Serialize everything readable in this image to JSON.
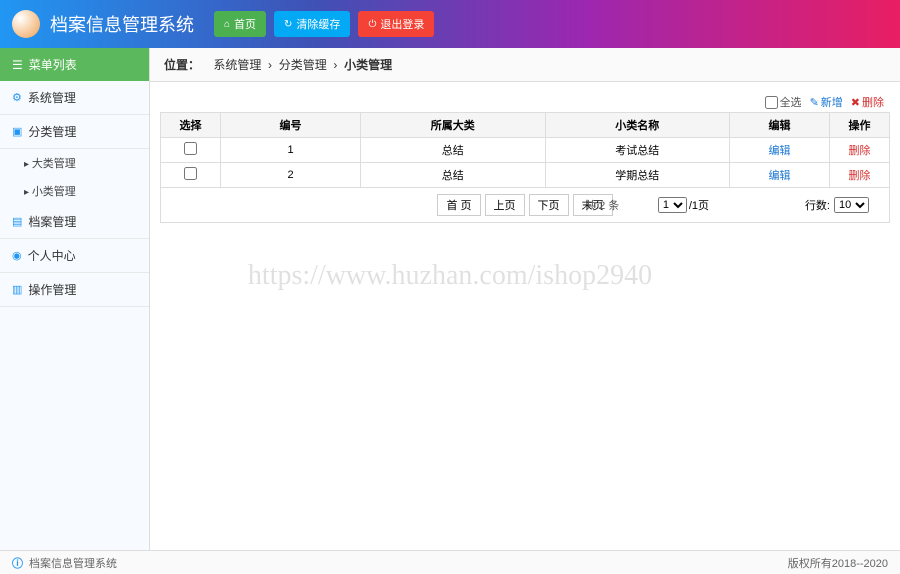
{
  "header": {
    "title": "档案信息管理系统",
    "home_label": "首页",
    "clear_label": "清除缓存",
    "logout_label": "退出登录"
  },
  "sidebar": {
    "menu_title": "菜单列表",
    "items": [
      {
        "label": "系统管理"
      },
      {
        "label": "分类管理",
        "subs": [
          "大类管理",
          "小类管理"
        ]
      },
      {
        "label": "档案管理"
      },
      {
        "label": "个人中心"
      },
      {
        "label": "操作管理"
      }
    ]
  },
  "breadcrumb": {
    "label": "位置：",
    "path": [
      "系统管理",
      "分类管理",
      "小类管理"
    ]
  },
  "toolbar": {
    "select_all": "全选",
    "add_new": "新增",
    "delete": "删除"
  },
  "table": {
    "headers": [
      "选择",
      "编号",
      "所属大类",
      "小类名称",
      "编辑",
      "操作"
    ],
    "rows": [
      {
        "id": "1",
        "category": "总结",
        "name": "考试总结",
        "edit": "编辑",
        "del": "删除"
      },
      {
        "id": "2",
        "category": "总结",
        "name": "学期总结",
        "edit": "编辑",
        "del": "删除"
      }
    ]
  },
  "pager": {
    "first": "首 页",
    "prev": "上页",
    "next": "下页",
    "last": "末页",
    "total_prefix": "共",
    "total_count": "2",
    "total_suffix": "条",
    "page_current": "1",
    "page_total": "/1页",
    "rows_label": "行数:",
    "rows_value": "10"
  },
  "watermark": "https://www.huzhan.com/ishop2940",
  "footer": {
    "name": "档案信息管理系统",
    "copyright": "版权所有2018--2020"
  }
}
